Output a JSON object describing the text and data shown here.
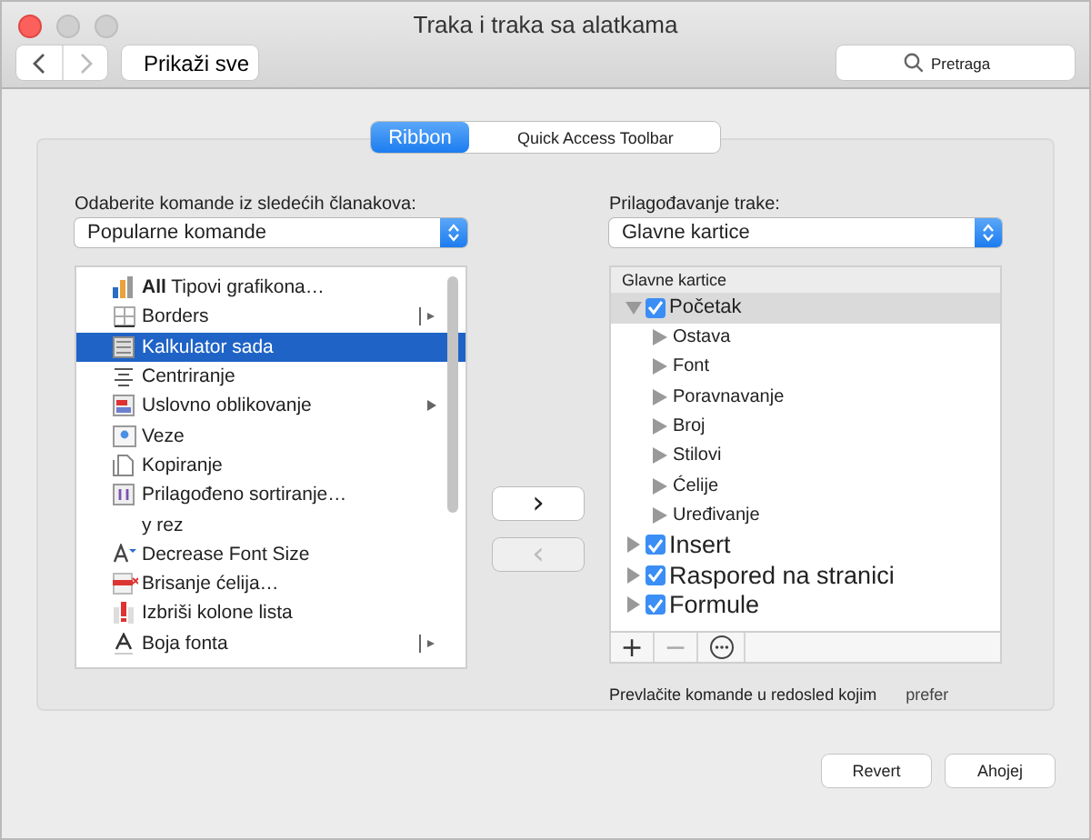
{
  "window": {
    "title": "Traka i traka sa alatkama"
  },
  "toolbar": {
    "show_all": "Prikaži sve",
    "search": {
      "placeholder": "Pretraga"
    }
  },
  "tabs": [
    {
      "label": "Ribbon",
      "selected": true
    },
    {
      "label": "Quick Access Toolbar",
      "selected": false
    }
  ],
  "left": {
    "label": "Odaberite komande iz sledećih članakova:",
    "dropdown": "Popularne komande",
    "items": [
      {
        "label": "**All** Tipovi grafikona…",
        "selected": false,
        "kind": "plain"
      },
      {
        "label": "Borders",
        "selected": false,
        "kind": "split"
      },
      {
        "label": "Kalkulator sada",
        "selected": true,
        "kind": "plain"
      },
      {
        "label": "Centriranje",
        "selected": false,
        "kind": "plain"
      },
      {
        "label": "Uslovno oblikovanje",
        "selected": false,
        "kind": "submenu"
      },
      {
        "label": "Veze",
        "selected": false,
        "kind": "plain"
      },
      {
        "label": "Kopiranje",
        "selected": false,
        "kind": "plain"
      },
      {
        "label": "Prilagođeno sortiranje…",
        "selected": false,
        "kind": "plain"
      },
      {
        "label": "y rez",
        "selected": false,
        "kind": "plain"
      },
      {
        "label": "Decrease Font Size",
        "selected": false,
        "kind": "plain"
      },
      {
        "label": "Brisanje ćelija…",
        "selected": false,
        "kind": "plain"
      },
      {
        "label": "Izbriši kolone lista",
        "selected": false,
        "kind": "plain"
      },
      {
        "label": "Boja fonta",
        "selected": false,
        "kind": "split"
      }
    ]
  },
  "move_buttons": [
    {
      "label": "›",
      "disabled": false
    },
    {
      "label": "‹",
      "disabled": true
    }
  ],
  "right": {
    "label": "Prilagođavanje trake:",
    "dropdown": "Glavne kartice",
    "tree_header": "Glavne kartice",
    "tree": [
      {
        "label": "Početak",
        "checked": true,
        "expanded": true,
        "selected": true,
        "children": [
          {
            "label": "Ostava"
          },
          {
            "label": "Font"
          },
          {
            "label": "Poravnavanje"
          },
          {
            "label": "Broj"
          },
          {
            "label": "Stilovi"
          },
          {
            "label": "Ćelije"
          },
          {
            "label": "Uređivanje"
          }
        ]
      },
      {
        "label": "Insert",
        "checked": true,
        "expanded": false,
        "selected": false
      },
      {
        "label": "Raspored na stranici",
        "checked": true,
        "expanded": false,
        "selected": false
      },
      {
        "label": "Formule",
        "checked": true,
        "expanded": false,
        "selected": false
      }
    ],
    "tree_buttons": [
      "+",
      "−"
    ],
    "hint": "Prevlačite komande u redosled kojim",
    "hint_2": "prefer"
  },
  "buttons": [
    "Revert",
    "Ahojej"
  ]
}
